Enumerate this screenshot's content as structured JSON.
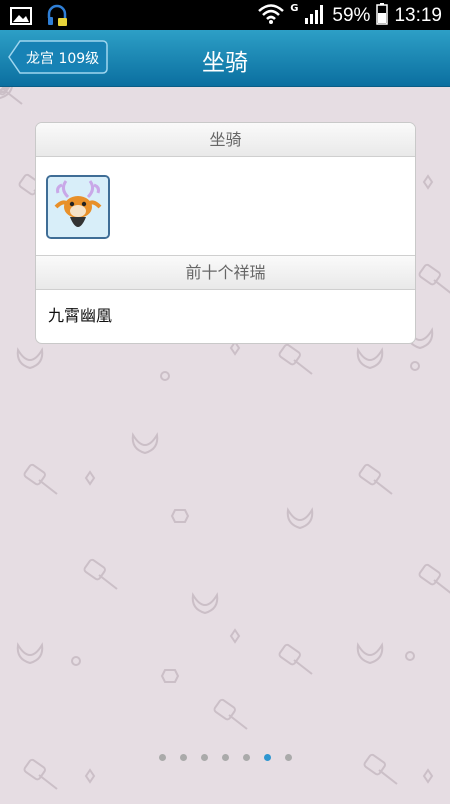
{
  "status_bar": {
    "battery_percent": "59%",
    "time": "13:19",
    "network_type": "G",
    "icons": [
      "gallery-icon",
      "headset-icon",
      "wifi-icon",
      "signal-icon",
      "battery-icon"
    ]
  },
  "header": {
    "back_label": "龙宫 109级",
    "title": "坐骑"
  },
  "card": {
    "mount_section_title": "坐骑",
    "mount_icon": "deer-mount-icon",
    "auspicious_section_title": "前十个祥瑞",
    "auspicious_items": [
      "九霄幽凰"
    ]
  },
  "pager": {
    "total": 7,
    "active_index": 5
  },
  "colors": {
    "header_top": "#2d9fc6",
    "header_bottom": "#0b6fa0",
    "background": "#e6dde3",
    "active_dot": "#2f96d0"
  }
}
